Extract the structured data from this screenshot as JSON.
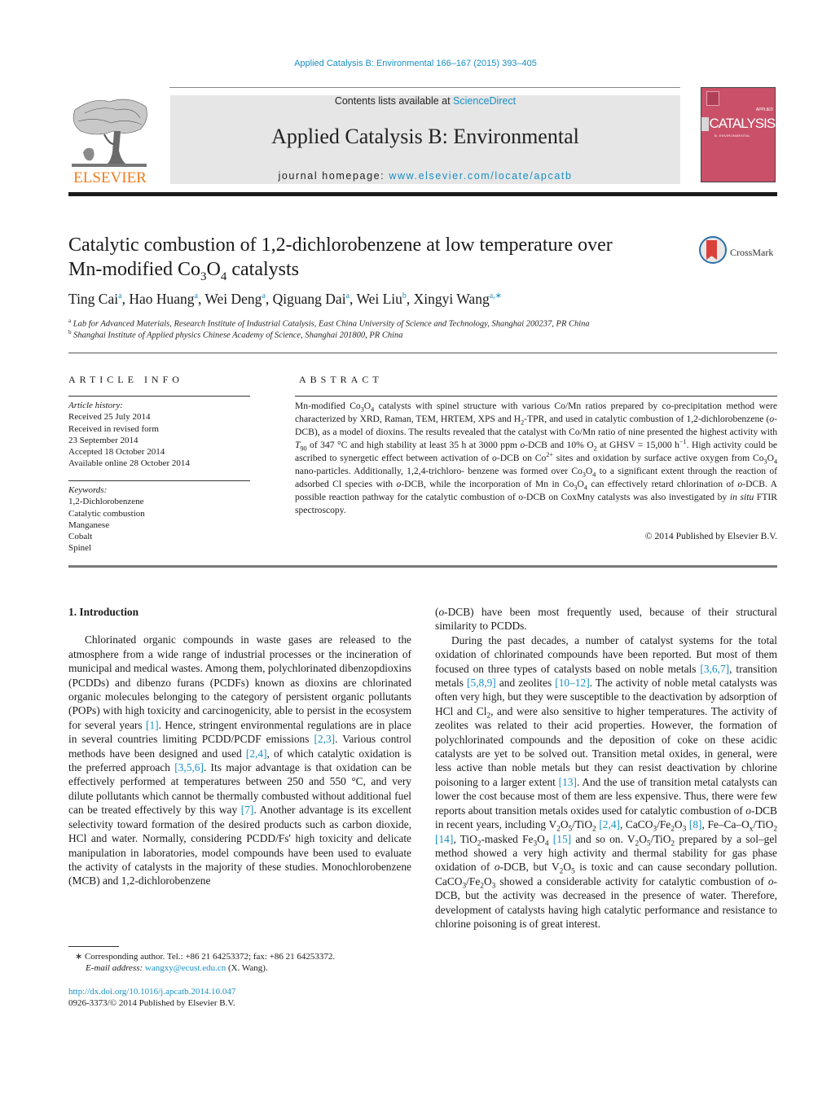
{
  "header": {
    "citation": "Applied Catalysis B: Environmental 166–167 (2015) 393–405",
    "contents_prefix": "Contents lists available at ",
    "contents_link": "ScienceDirect",
    "journal_title": "Applied Catalysis B: Environmental",
    "homepage_prefix": "journal homepage: ",
    "homepage_link": "www.elsevier.com/locate/apcatb",
    "publisher_logo_text": "ELSEVIER",
    "cover": {
      "title": "CATALYSIS",
      "small_top": "APPLIED",
      "subtitle": "B: ENVIRONMENTAL",
      "color": "#c95068"
    }
  },
  "article": {
    "title_line1": "Catalytic combustion of 1,2-dichlorobenzene at low temperature over",
    "title_line2_pre": "Mn-modified Co",
    "title_sub1": "3",
    "title_mid": "O",
    "title_sub2": "4",
    "title_post": " catalysts",
    "crossmark_label": "CrossMark",
    "authors": [
      {
        "name": "Ting Cai",
        "aff": "a"
      },
      {
        "name": "Hao Huang",
        "aff": "a"
      },
      {
        "name": "Wei Deng",
        "aff": "a"
      },
      {
        "name": "Qiguang Dai",
        "aff": "a"
      },
      {
        "name": "Wei Liu",
        "aff": "b"
      },
      {
        "name": "Xingyi Wang",
        "aff": "a,∗"
      }
    ],
    "affiliations": [
      {
        "mark": "a",
        "text": "Lab for Advanced Materials, Research Institute of Industrial Catalysis, East China University of Science and Technology, Shanghai 200237, PR China"
      },
      {
        "mark": "b",
        "text": "Shanghai Institute of Applied physics Chinese Academy of Science, Shanghai 201800, PR China"
      }
    ]
  },
  "article_info": {
    "label": "ARTICLE INFO",
    "history_heading": "Article history:",
    "history": [
      "Received 25 July 2014",
      "Received in revised form",
      "23 September 2014",
      "Accepted 18 October 2014",
      "Available online 28 October 2014"
    ],
    "keywords_heading": "Keywords:",
    "keywords": [
      "1,2-Dichlorobenzene",
      "Catalytic combustion",
      "Manganese",
      "Cobalt",
      "Spinel"
    ]
  },
  "abstract": {
    "label": "ABSTRACT",
    "t1": "Mn-modified Co",
    "t2": "O",
    "t3": " catalysts with spinel structure with various Co/Mn ratios prepared by co-precipitation method were characterized by XRD, Raman, TEM, HRTEM, XPS and H",
    "t4": "-TPR, and used in catalytic combustion of 1,2-dichlorobenzene (",
    "t5": "o",
    "t6": "-DCB), as a model of dioxins. The results revealed that the catalyst with Co/Mn ratio of nine presented the highest activity with ",
    "t7": "T",
    "t7sub": "90",
    "t8": " of 347 °C and high stability at least 35 h at 3000 ppm ",
    "t9": "o",
    "t10": "-DCB and 10% O",
    "t11": " at GHSV = 15,000 h",
    "t11sup": "−1",
    "t12": ". High activity could be ascribed to synergetic effect between activation of ",
    "t13": "o",
    "t14": "-DCB on Co",
    "t14sup": "2+",
    "t15": " sites and oxidation by surface active oxygen from Co",
    "t16": "O",
    "t17": " nano-particles. Additionally, 1,2,4-trichloro- benzene was formed over Co",
    "t18": "O",
    "t19": " to a significant extent through the reaction of adsorbed Cl species with ",
    "t20": "o",
    "t21": "-DCB, while the incorporation of Mn in Co",
    "t22": "O",
    "t23": " can effectively retard chlorination of ",
    "t24": "o",
    "t25": "-DCB. A possible reaction pathway for the catalytic combustion of o-DCB on CoxMny catalysts was also investigated by ",
    "t26": "in situ",
    "t27": " FTIR spectroscopy.",
    "sub3": "3",
    "sub4": "4",
    "sub2": "2",
    "copyright": "© 2014 Published by Elsevier B.V."
  },
  "body": {
    "section_heading": "1.  Introduction",
    "left": {
      "p1a": "Chlorinated organic compounds in waste gases are released to the atmosphere from a wide range of industrial processes or the incineration of municipal and medical wastes. Among them, polychlorinated dibenzopdioxins (PCDDs) and dibenzo furans (PCDFs) known as dioxins are chlorinated organic molecules belonging to the category of persistent organic pollutants (POPs) with high toxicity and carcinogenicity, able to persist in the ecosystem for several years ",
      "r1": "[1]",
      "p1b": ". Hence, stringent environmental regulations are in place in several countries limiting PCDD/PCDF emissions ",
      "r2": "[2,3]",
      "p1c": ". Various control methods have been designed and used ",
      "r3": "[2,4]",
      "p1d": ", of which catalytic oxidation is the preferred approach ",
      "r4": "[3,5,6]",
      "p1e": ". Its major advantage is that oxidation can be effectively performed at temperatures between 250 and 550 °C, and very dilute pollutants which cannot be thermally combusted without additional fuel can be treated effectively by this way ",
      "r5": "[7]",
      "p1f": ". Another advantage is its excellent selectivity toward formation of the desired products such as carbon dioxide, HCl and water. Normally, considering PCDD/Fs' high toxicity and delicate manipulation in laboratories, model compounds have been used to evaluate the activity of catalysts in the majority of these studies. Monochlorobenzene (MCB) and 1,2-dichlorobenzene"
    },
    "right": {
      "p1a": "(",
      "p1o": "o",
      "p1b": "-DCB) have been most frequently used, because of their structural similarity to PCDDs.",
      "p2a": "During the past decades, a number of catalyst systems for the total oxidation of chlorinated compounds have been reported. But most of them focused on three types of catalysts based on noble metals ",
      "r1": "[3,6,7]",
      "p2b": ", transition metals ",
      "r2": "[5,8,9]",
      "p2c": " and zeolites ",
      "r3": "[10–12]",
      "p2d": ". The activity of noble metal catalysts was often very high, but they were susceptible to the deactivation by adsorption of HCl and Cl",
      "p2e": ", and were also sensitive to higher temperatures. The activity of zeolites was related to their acid properties. However, the formation of polychlorinated compounds and the deposition of coke on these acidic catalysts are yet to be solved out. Transition metal oxides, in general, were less active than noble metals but they can resist deactivation by chlorine poisoning to a larger extent ",
      "r4": "[13]",
      "p2f": ". And the use of transition metal catalysts can lower the cost because most of them are less expensive. Thus, there were few reports about transition metals oxides used for catalytic combustion of ",
      "p2g": "-DCB in recent years, including V",
      "r5": "[2,4]",
      "r6": "[8]",
      "r7": "[14]",
      "r8": "[15]",
      "p2h": " and so on. V",
      "p2i": " prepared by a sol–gel method showed a very high activity and thermal stability for gas phase oxidation of ",
      "p2j": "-DCB, but V",
      "p2k": " is toxic and can cause secondary pollution. CaCO",
      "p2l": " showed a considerable activity for catalytic combustion of ",
      "p2m": "-DCB, but the activity was decreased in the presence of water. Therefore, development of catalysts having high catalytic performance and resistance to chlorine poisoning is of great interest."
    }
  },
  "footnotes": {
    "corresponding": "∗  Corresponding author. Tel.: +86 21 64253372; fax: +86 21 64253372.",
    "email_label": "E-mail address: ",
    "email": "wangxy@ecust.edu.cn",
    "email_suffix": " (X. Wang).",
    "doi": "http://dx.doi.org/10.1016/j.apcatb.2014.10.047",
    "issn": "0926-3373/© 2014 Published by Elsevier B.V."
  }
}
